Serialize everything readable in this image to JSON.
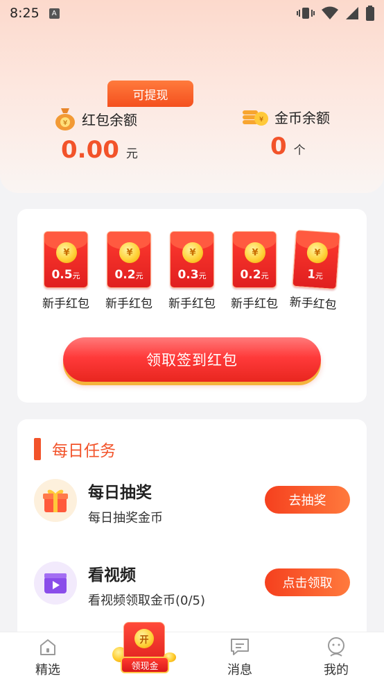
{
  "status_bar": {
    "time": "8:25",
    "notif_icon_text": "A"
  },
  "balances": {
    "withdraw_tag": "可提现",
    "red_packet": {
      "label": "红包余额",
      "value": "0.00",
      "unit": "元",
      "icon": "money-bag-icon"
    },
    "coins": {
      "label": "金币余额",
      "value": "0",
      "unit": "个",
      "icon": "coin-stack-icon"
    }
  },
  "envelopes": {
    "items": [
      {
        "amount": "0.5",
        "unit": "元",
        "label": "新手红包"
      },
      {
        "amount": "0.2",
        "unit": "元",
        "label": "新手红包"
      },
      {
        "amount": "0.3",
        "unit": "元",
        "label": "新手红包"
      },
      {
        "amount": "0.2",
        "unit": "元",
        "label": "新手红包"
      },
      {
        "amount": "1",
        "unit": "元",
        "label": "新手红包"
      }
    ],
    "coin_symbol": "¥",
    "sign_button": "领取签到红包"
  },
  "tasks": {
    "title": "每日任务",
    "items": [
      {
        "title": "每日抽奖",
        "desc": "每日抽奖金币",
        "button": "去抽奖",
        "icon": "gift-icon"
      },
      {
        "title": "看视频",
        "desc": "看视频领取金币(0/5)",
        "button": "点击领取",
        "icon": "video-icon"
      }
    ]
  },
  "nav": {
    "items": [
      {
        "label": "精选",
        "icon": "home-icon"
      },
      {
        "label": "消息",
        "icon": "message-icon"
      },
      {
        "label": "我的",
        "icon": "profile-icon"
      }
    ],
    "center": {
      "coin_text": "开",
      "badge": "领现金"
    }
  },
  "colors": {
    "accent": "#f2532a",
    "red": "#e8261f",
    "gold": "#ffd23a"
  }
}
